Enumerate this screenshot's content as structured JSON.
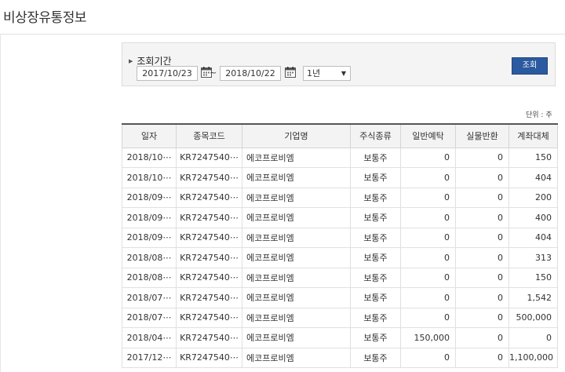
{
  "page": {
    "title": "비상장유통정보"
  },
  "search": {
    "label": "조회기간",
    "date_from": "2017/10/23",
    "separator": "~",
    "date_to": "2018/10/22",
    "period_selected": "1년",
    "button_label": "조회"
  },
  "unit_label": "단위 : 주",
  "table": {
    "headers": [
      "일자",
      "종목코드",
      "기업명",
      "주식종류",
      "일반예탁",
      "실물반환",
      "계좌대체"
    ],
    "rows": [
      [
        "2018/10⋯",
        "KR7247540⋯",
        "에코프로비엠",
        "보통주",
        "0",
        "0",
        "150"
      ],
      [
        "2018/10⋯",
        "KR7247540⋯",
        "에코프로비엠",
        "보통주",
        "0",
        "0",
        "404"
      ],
      [
        "2018/09⋯",
        "KR7247540⋯",
        "에코프로비엠",
        "보통주",
        "0",
        "0",
        "200"
      ],
      [
        "2018/09⋯",
        "KR7247540⋯",
        "에코프로비엠",
        "보통주",
        "0",
        "0",
        "400"
      ],
      [
        "2018/09⋯",
        "KR7247540⋯",
        "에코프로비엠",
        "보통주",
        "0",
        "0",
        "404"
      ],
      [
        "2018/08⋯",
        "KR7247540⋯",
        "에코프로비엠",
        "보통주",
        "0",
        "0",
        "313"
      ],
      [
        "2018/08⋯",
        "KR7247540⋯",
        "에코프로비엠",
        "보통주",
        "0",
        "0",
        "150"
      ],
      [
        "2018/07⋯",
        "KR7247540⋯",
        "에코프로비엠",
        "보통주",
        "0",
        "0",
        "1,542"
      ],
      [
        "2018/07⋯",
        "KR7247540⋯",
        "에코프로비엠",
        "보통주",
        "0",
        "0",
        "500,000"
      ],
      [
        "2018/04⋯",
        "KR7247540⋯",
        "에코프로비엠",
        "보통주",
        "150,000",
        "0",
        "0"
      ],
      [
        "2017/12⋯",
        "KR7247540⋯",
        "에코프로비엠",
        "보통주",
        "0",
        "0",
        "1,100,000"
      ]
    ]
  },
  "colors": {
    "button": "#2c5aa0",
    "header_bg": "#f3f3f3",
    "search_bg": "#f4f4f4"
  },
  "icons": {
    "calendar": "calendar-icon",
    "dropdown": "chevron-down-icon",
    "bullet": "triangle-right-icon"
  }
}
